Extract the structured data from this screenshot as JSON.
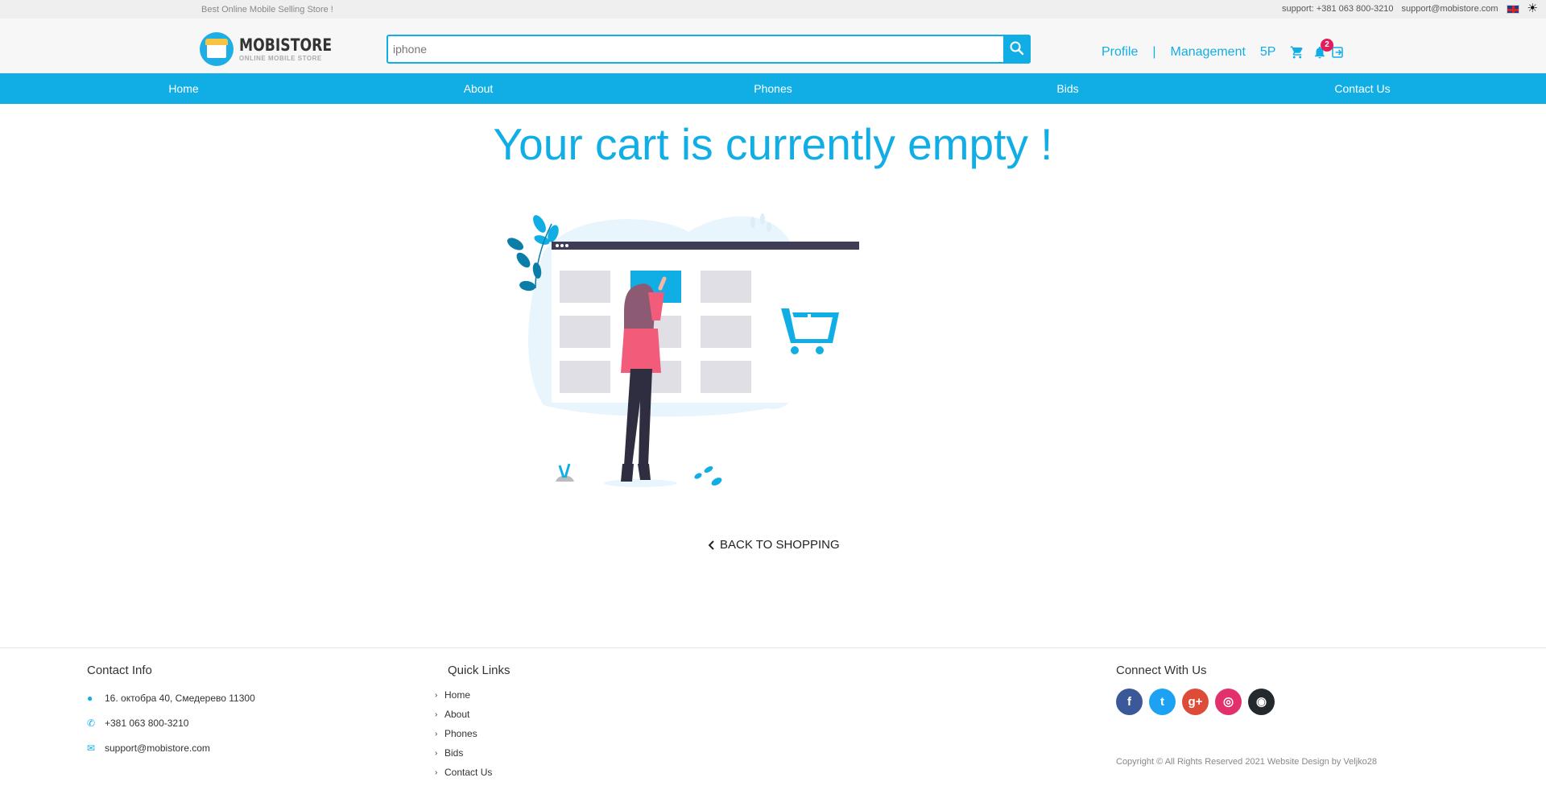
{
  "topbar": {
    "tagline": "Best Online Mobile Selling Store !",
    "support_phone": "support: +381 063 800-3210",
    "support_email": "support@mobistore.com"
  },
  "header": {
    "logo_title": "MOBISTORE",
    "logo_subtitle": "ONLINE MOBILE STORE",
    "search_value": "iphone",
    "profile_label": "Profile",
    "separator": "|",
    "management_label": "Management",
    "points": "5P",
    "notification_count": "2"
  },
  "nav": {
    "items": [
      "Home",
      "About",
      "Phones",
      "Bids",
      "Contact Us"
    ]
  },
  "main": {
    "title": "Your cart is currently empty !",
    "back_label": "BACK TO SHOPPING"
  },
  "footer": {
    "contact_heading": "Contact Info",
    "address": "16. октобра 40, Смедерево 11300",
    "phone": "+381 063 800-3210",
    "email": "support@mobistore.com",
    "quicklinks_heading": "Quick Links",
    "quicklinks": [
      "Home",
      "About",
      "Phones",
      "Bids",
      "Contact Us"
    ],
    "connect_heading": "Connect With Us",
    "socials": [
      {
        "name": "facebook",
        "glyph": "f",
        "color": "#3b5998"
      },
      {
        "name": "twitter",
        "glyph": "t",
        "color": "#1da1f2"
      },
      {
        "name": "google-plus",
        "glyph": "g+",
        "color": "#dd4b39"
      },
      {
        "name": "instagram",
        "glyph": "◎",
        "color": "#e1306c"
      },
      {
        "name": "github",
        "glyph": "◉",
        "color": "#24292e"
      }
    ],
    "copyright": "Copyright © All Rights Reserved 2021 Website Design by Veljko28"
  },
  "colors": {
    "accent": "#11aee5",
    "badge": "#e51c5a"
  }
}
